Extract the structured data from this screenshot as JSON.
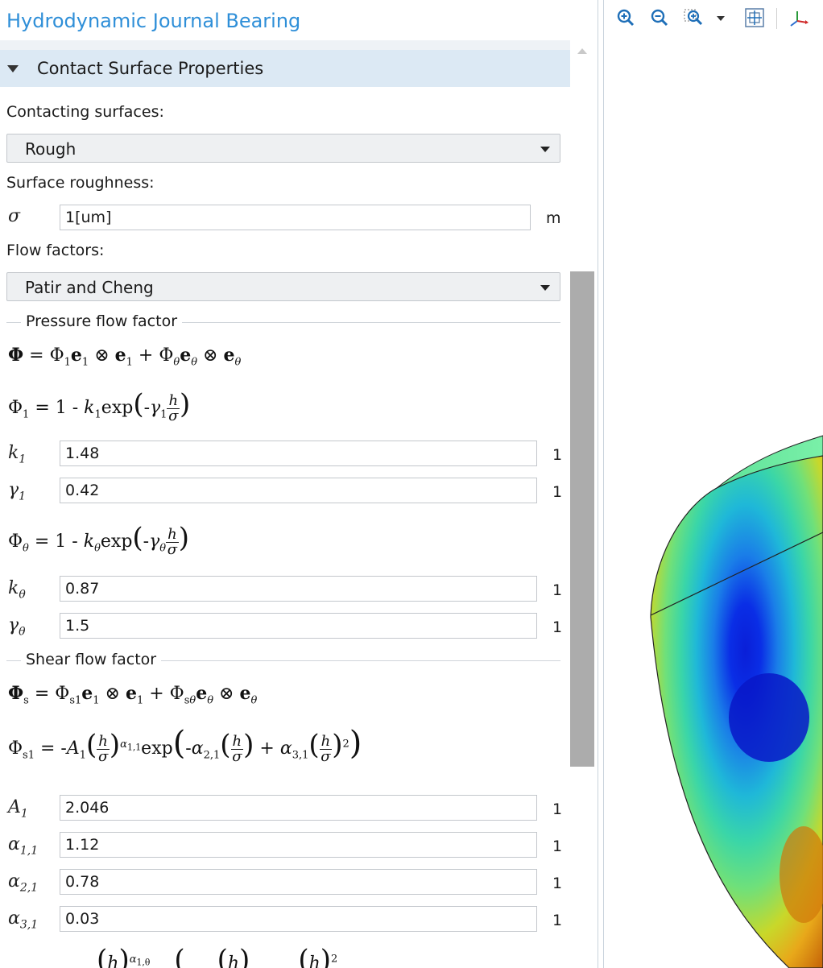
{
  "header": {
    "feature_title": "Hydrodynamic Journal Bearing"
  },
  "section": {
    "title": "Contact Surface Properties"
  },
  "contacting_surfaces": {
    "label": "Contacting surfaces:",
    "selected": "Rough"
  },
  "surface_roughness": {
    "label": "Surface roughness:",
    "symbol": "σ",
    "value": "1[um]",
    "unit": "m"
  },
  "flow_factors": {
    "label": "Flow factors:",
    "selected": "Patir and Cheng"
  },
  "pressure_flow_factor": {
    "title": "Pressure flow factor",
    "k1": {
      "symbol": "k",
      "sub": "1",
      "value": "1.48",
      "unit": "1"
    },
    "gamma1": {
      "symbol": "γ",
      "sub": "1",
      "value": "0.42",
      "unit": "1"
    },
    "ktheta": {
      "symbol": "k",
      "sub": "θ",
      "value": "0.87",
      "unit": "1"
    },
    "gammatheta": {
      "symbol": "γ",
      "sub": "θ",
      "value": "1.5",
      "unit": "1"
    }
  },
  "shear_flow_factor": {
    "title": "Shear flow factor",
    "A1": {
      "symbol": "A",
      "sub": "1",
      "value": "2.046",
      "unit": "1"
    },
    "alpha11": {
      "symbol": "α",
      "sub": "1,1",
      "value": "1.12",
      "unit": "1"
    },
    "alpha21": {
      "symbol": "α",
      "sub": "2,1",
      "value": "0.78",
      "unit": "1"
    },
    "alpha31": {
      "symbol": "α",
      "sub": "3,1",
      "value": "0.03",
      "unit": "1"
    }
  },
  "toolbar": {
    "icons": [
      "zoom-in-icon",
      "zoom-out-icon",
      "zoom-box-icon",
      "dropdown-arrow-icon",
      "zoom-extents-icon",
      "axis-orientation-icon"
    ]
  },
  "colors": {
    "accent": "#2f8fd8",
    "section_bg": "#dce9f4",
    "scroll_thumb": "#acacac"
  }
}
